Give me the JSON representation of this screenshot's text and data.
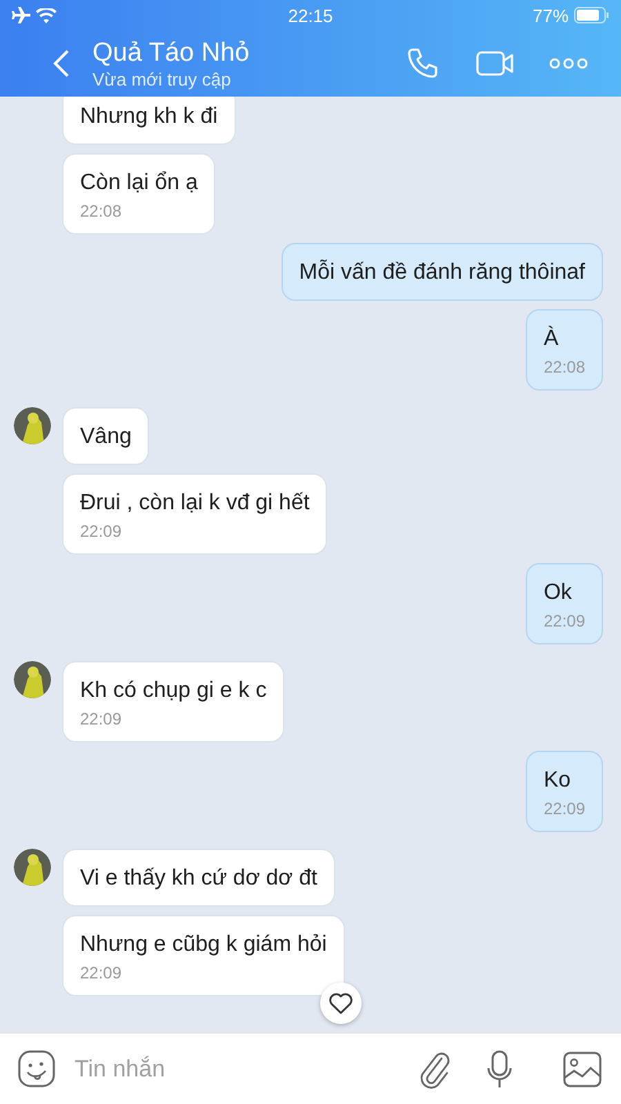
{
  "status_bar": {
    "time": "22:15",
    "battery": "77%"
  },
  "header": {
    "title": "Quả Táo Nhỏ",
    "subtitle": "Vừa mới truy cập"
  },
  "messages": [
    {
      "kind": "incoming",
      "text": "Nhưng kh k đi",
      "avatar": false
    },
    {
      "kind": "incoming",
      "text": "Còn lại ổn ạ",
      "time": "22:08",
      "avatar": false
    },
    {
      "kind": "outgoing",
      "text": "Mỗi vấn đề đánh răng thôinaf"
    },
    {
      "kind": "outgoing",
      "text": "À",
      "time": "22:08"
    },
    {
      "kind": "incoming",
      "text": "Vâng",
      "avatar": true
    },
    {
      "kind": "incoming",
      "text": "Đrui , còn lại k vđ gi hết",
      "time": "22:09",
      "avatar": false
    },
    {
      "kind": "outgoing",
      "text": "Ok",
      "time": "22:09"
    },
    {
      "kind": "incoming",
      "text": "Kh có chụp gi e k c",
      "time": "22:09",
      "avatar": true
    },
    {
      "kind": "outgoing",
      "text": "Ko",
      "time": "22:09"
    },
    {
      "kind": "incoming",
      "text": "Vi e thấy kh cứ dơ dơ đt",
      "avatar": true
    },
    {
      "kind": "incoming",
      "text": "Nhưng e cũbg k giám hỏi",
      "time": "22:09",
      "avatar": false,
      "reaction_button": true
    }
  ],
  "composer": {
    "placeholder": "Tin nhắn"
  }
}
